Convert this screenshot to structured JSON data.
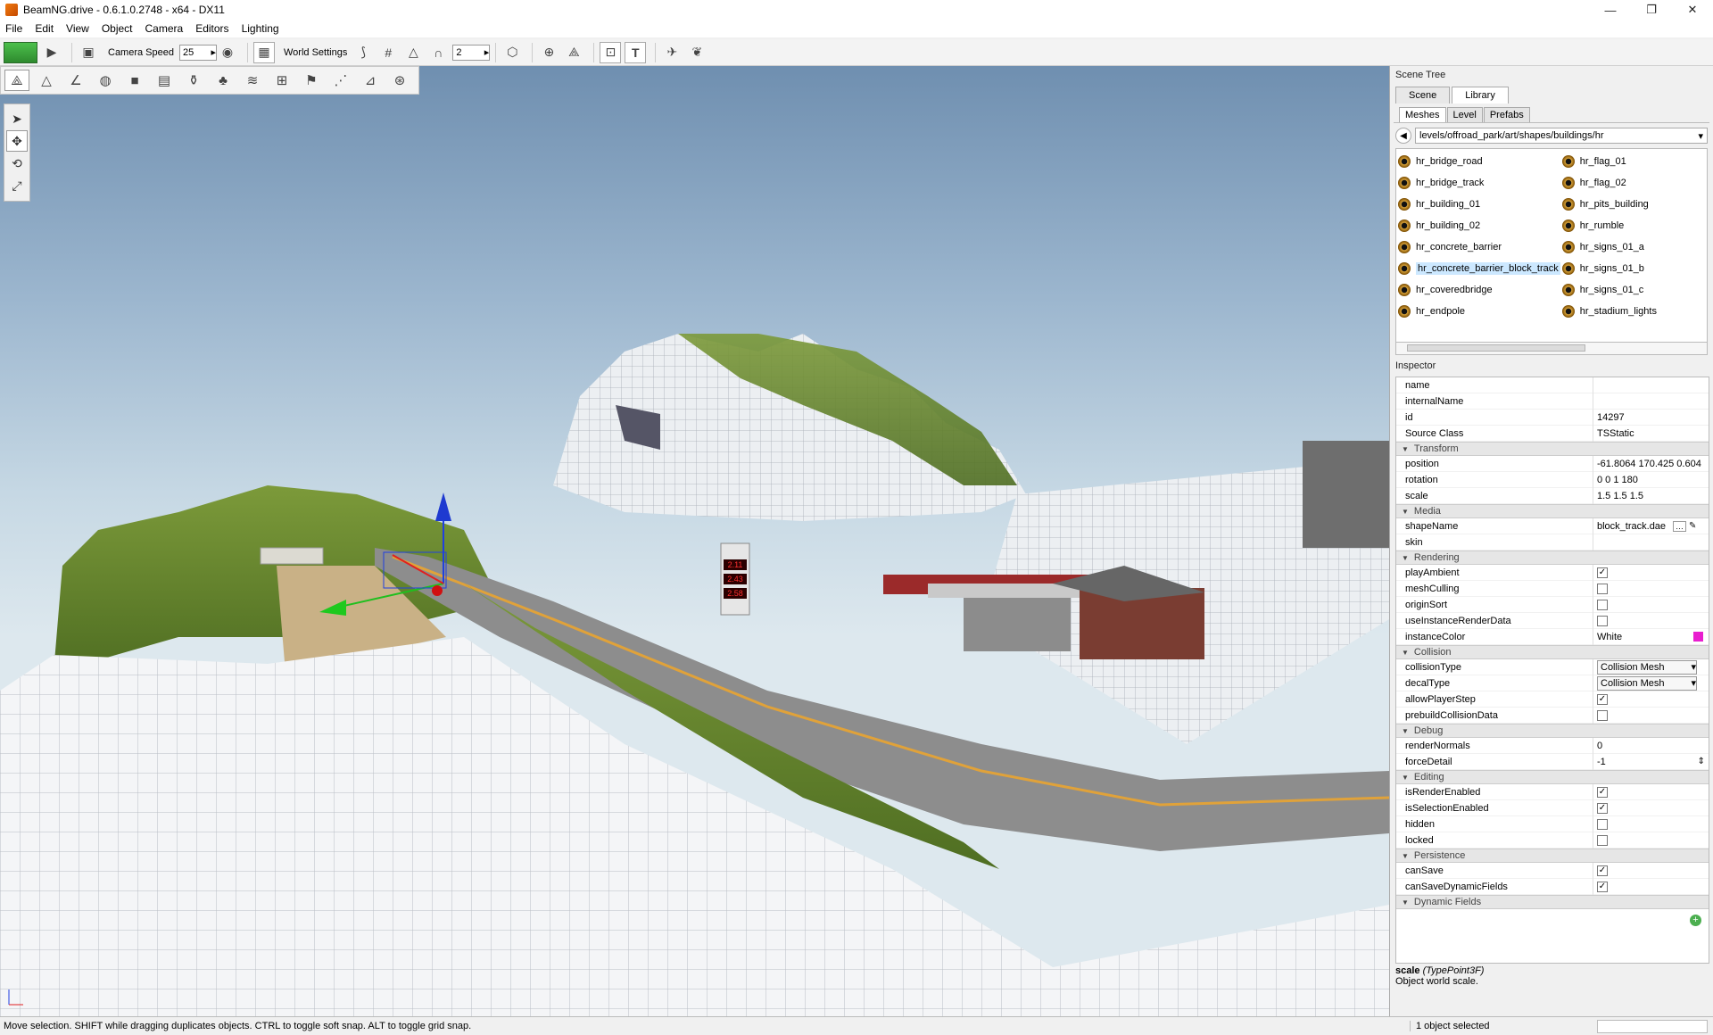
{
  "window": {
    "title": "BeamNG.drive - 0.6.1.0.2748 - x64 - DX11",
    "minimize": "—",
    "maximize": "❐",
    "close": "✕"
  },
  "menu": [
    "File",
    "Edit",
    "View",
    "Object",
    "Camera",
    "Editors",
    "Lighting"
  ],
  "toolbar": {
    "camera_speed_label": "Camera Speed",
    "camera_speed_value": "25",
    "world_settings_label": "World Settings",
    "grid_value": "2"
  },
  "scene_tree": {
    "title": "Scene Tree",
    "tabs": [
      "Scene",
      "Library"
    ],
    "subtabs": [
      "Meshes",
      "Level",
      "Prefabs"
    ],
    "path": "levels/offroad_park/art/shapes/buildings/hr",
    "meshes_left": [
      "hr_bridge_road",
      "hr_bridge_track",
      "hr_building_01",
      "hr_building_02",
      "hr_concrete_barrier",
      "hr_concrete_barrier_block_track",
      "hr_coveredbridge",
      "hr_endpole"
    ],
    "meshes_right": [
      "hr_flag_01",
      "hr_flag_02",
      "hr_pits_building",
      "hr_rumble",
      "hr_signs_01_a",
      "hr_signs_01_b",
      "hr_signs_01_c",
      "hr_stadium_lights"
    ]
  },
  "inspector": {
    "title": "Inspector",
    "general": [
      {
        "k": "name",
        "v": ""
      },
      {
        "k": "internalName",
        "v": ""
      },
      {
        "k": "id",
        "v": "14297"
      },
      {
        "k": "Source Class",
        "v": "TSStatic"
      }
    ],
    "transform": {
      "label": "Transform",
      "rows": [
        {
          "k": "position",
          "v": "-61.8064 170.425 0.604"
        },
        {
          "k": "rotation",
          "v": "0 0 1 180"
        },
        {
          "k": "scale",
          "v": "1.5 1.5 1.5"
        }
      ]
    },
    "media": {
      "label": "Media",
      "shape_name_key": "shapeName",
      "shape_name_value": "block_track.dae",
      "skin_key": "skin"
    },
    "rendering": {
      "label": "Rendering",
      "rows": [
        {
          "k": "playAmbient",
          "checked": true
        },
        {
          "k": "meshCulling",
          "checked": false
        },
        {
          "k": "originSort",
          "checked": false
        },
        {
          "k": "useInstanceRenderData",
          "checked": false
        }
      ],
      "instance_color_key": "instanceColor",
      "instance_color_value": "White",
      "instance_color_swatch": "#e91ecf"
    },
    "collision": {
      "label": "Collision",
      "collision_type_key": "collisionType",
      "collision_type_value": "Collision Mesh",
      "decal_type_key": "decalType",
      "decal_type_value": "Collision Mesh",
      "rows": [
        {
          "k": "allowPlayerStep",
          "checked": true
        },
        {
          "k": "prebuildCollisionData",
          "checked": false
        }
      ]
    },
    "debug": {
      "label": "Debug",
      "render_normals_key": "renderNormals",
      "render_normals_value": "0",
      "force_detail_key": "forceDetail",
      "force_detail_value": "-1"
    },
    "editing": {
      "label": "Editing",
      "rows": [
        {
          "k": "isRenderEnabled",
          "checked": true
        },
        {
          "k": "isSelectionEnabled",
          "checked": true
        },
        {
          "k": "hidden",
          "checked": false
        },
        {
          "k": "locked",
          "checked": false
        }
      ]
    },
    "persistence": {
      "label": "Persistence",
      "rows": [
        {
          "k": "canSave",
          "checked": true
        },
        {
          "k": "canSaveDynamicFields",
          "checked": true
        }
      ]
    },
    "dynamic": {
      "label": "Dynamic Fields"
    },
    "help_field": "scale",
    "help_type": "(TypePoint3F)",
    "help_desc": "Object world scale."
  },
  "viewport": {
    "sign_values": [
      "2.11",
      "2.43",
      "2.58"
    ]
  },
  "status": {
    "left": "Move selection.  SHIFT while dragging duplicates objects.  CTRL to toggle soft snap.  ALT to toggle grid snap.",
    "right": "1 object selected"
  }
}
